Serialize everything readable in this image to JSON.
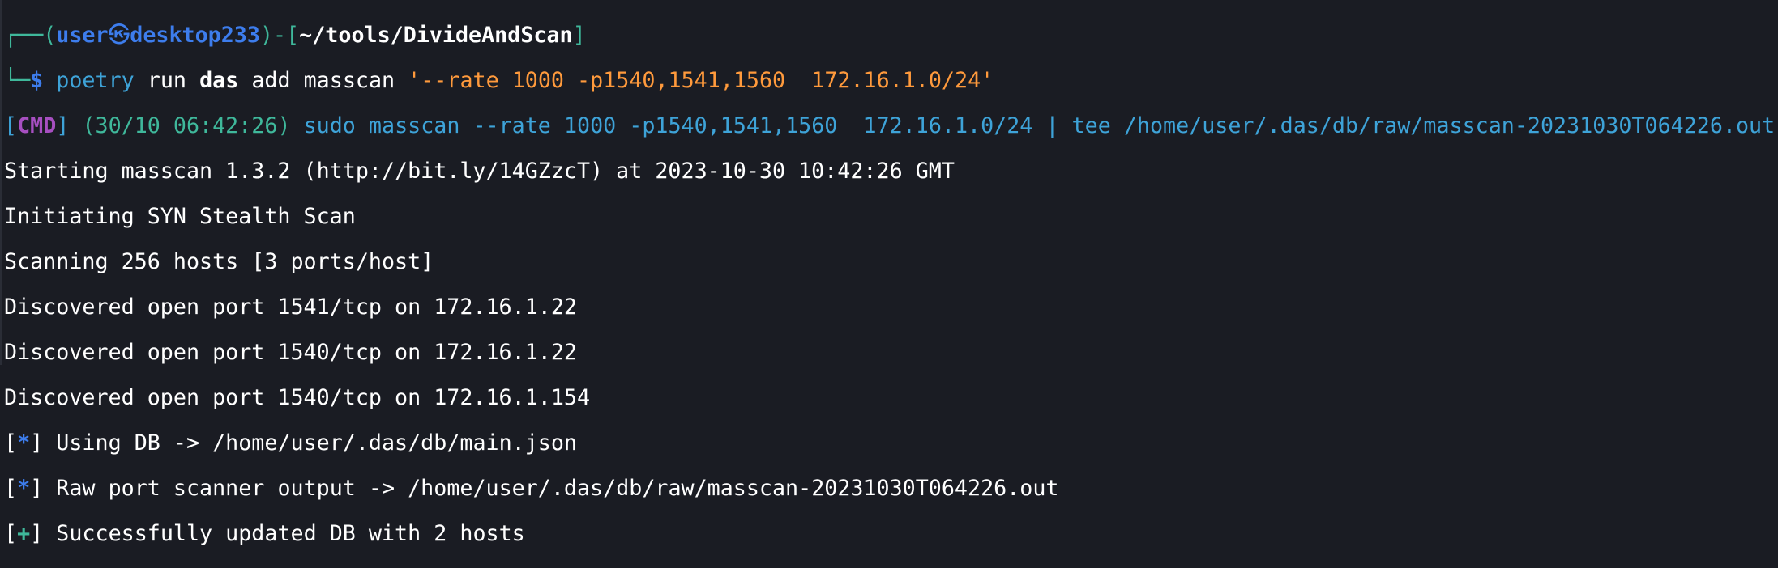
{
  "prompt": {
    "corner_top": "┌──",
    "open_paren": "(",
    "user": "user",
    "skull": "㉿",
    "host": "desktop233",
    "close_paren": ")",
    "dash": "-",
    "open_bracket": "[",
    "cwd": "~/tools/DivideAndScan",
    "close_bracket": "]",
    "corner_bottom": "└─",
    "dollar": "$"
  },
  "command": {
    "program": "poetry",
    "arg1": "run",
    "arg2": "das",
    "arg3": "add masscan",
    "quoted": "'--rate 1000 -p1540,1541,1560  172.16.1.0/24'"
  },
  "cmd_line": {
    "tag": "CMD",
    "timestamp": "(30/10 06:42:26)",
    "command": "sudo masscan --rate 1000 -p1540,1541,1560  172.16.1.0/24 | tee /home/user/.das/db/raw/masscan-20231030T064226.out"
  },
  "output": [
    "Starting masscan 1.3.2 (http://bit.ly/14GZzcT) at 2023-10-30 10:42:26 GMT",
    "Initiating SYN Stealth Scan",
    "Scanning 256 hosts [3 ports/host]",
    "Discovered open port 1541/tcp on 172.16.1.22",
    "Discovered open port 1540/tcp on 172.16.1.22",
    "Discovered open port 1540/tcp on 172.16.1.154"
  ],
  "status": [
    {
      "symbol": "*",
      "text": "Using DB -> /home/user/.das/db/main.json"
    },
    {
      "symbol": "*",
      "text": "Raw port scanner output -> /home/user/.das/db/raw/masscan-20231030T064226.out"
    },
    {
      "symbol": "+",
      "text": "Successfully updated DB with 2 hosts"
    }
  ],
  "colors": {
    "background": "#1a1c23",
    "prompt_frame": "#3fb89b",
    "user_host": "#3d7ded",
    "command": "#3ea3d8",
    "string": "#ff9a3c",
    "cmd_tag": "#a74fc1"
  }
}
